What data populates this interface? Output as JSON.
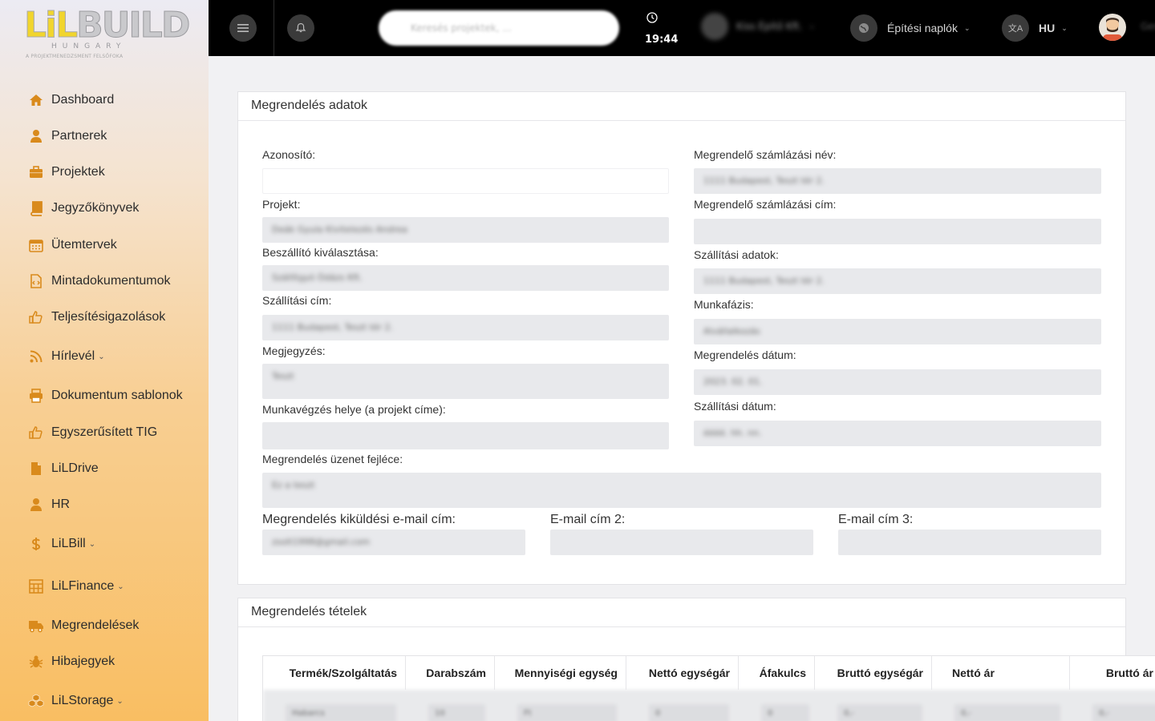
{
  "logo": {
    "li": "LiL",
    "build": "BUILD",
    "country": "HUNGARY",
    "tagline": "A PROJEKTMENEDZSMENT FELSŐFOKA"
  },
  "sidebar": {
    "items": [
      {
        "label": "Dashboard",
        "icon": "home-icon"
      },
      {
        "label": "Partnerek",
        "icon": "user-icon"
      },
      {
        "label": "Projektek",
        "icon": "briefcase-icon"
      },
      {
        "label": "Jegyzőkönyvek",
        "icon": "book-icon"
      },
      {
        "label": "Ütemtervek",
        "icon": "calendar-icon"
      },
      {
        "label": "Mintadokumentumok",
        "icon": "file-code-icon"
      },
      {
        "label": "Teljesítésigazolások",
        "icon": "thumbs-up-icon"
      },
      {
        "label": "Hírlevél",
        "icon": "rss-icon",
        "caret": "⌄"
      },
      {
        "label": "Dokumentum sablonok",
        "icon": "printer-icon"
      },
      {
        "label": "Egyszerűsített TIG",
        "icon": "thumbs-up-icon"
      },
      {
        "label": "LiLDrive",
        "icon": "file-icon"
      },
      {
        "label": "HR",
        "icon": "user-icon"
      },
      {
        "label": "LiLBill",
        "icon": "dollar-icon",
        "caret": "⌄"
      },
      {
        "label": "LiLFinance",
        "icon": "calculator-icon",
        "caret": "⌄"
      },
      {
        "label": "Megrendelések",
        "icon": "truck-icon"
      },
      {
        "label": "Hibajegyek",
        "icon": "bug-icon"
      },
      {
        "label": "LiLStorage",
        "icon": "cubes-icon",
        "caret": "⌄"
      }
    ]
  },
  "topbar": {
    "search_placeholder": "Keresés projektek, ...",
    "time": "19:44",
    "user_menu": "Kiss Építő Kft.",
    "logs_menu": "Építési naplók",
    "lang": "HU",
    "user_name": "Ger"
  },
  "order_card": {
    "title": "Megrendelés adatok",
    "left": [
      {
        "label": "Azonosító:",
        "value": ""
      },
      {
        "label": "Projekt:",
        "value": "Deák Gyula Kivitelezés Andrea"
      },
      {
        "label": "Beszállító kiválasztása:",
        "value": "Szállítgyó Ódázs Kft."
      },
      {
        "label": "Szállítási cím:",
        "value": "1111 Budapest, Teszt tér 2."
      },
      {
        "label": "Megjegyzés:",
        "value": "Teszt"
      },
      {
        "label": "Munkavégzés helye (a projekt címe):",
        "value": ""
      }
    ],
    "right": [
      {
        "label": "Megrendelő számlázási név:",
        "value": "1111 Budapest, Teszt tér 2."
      },
      {
        "label": "Megrendelő számlázási cím:",
        "value": ""
      },
      {
        "label": "Szállítási adatok:",
        "value": "1111 Budapest, Teszt tér 2."
      },
      {
        "label": "Munkafázis:",
        "value": "Alvállalkozás"
      },
      {
        "label": "Megrendelés dátum:",
        "value": "2023. 02. 01."
      },
      {
        "label": "Szállítási dátum:",
        "value": "éééé. hh. nn."
      }
    ],
    "message_header": {
      "label": "Megrendelés üzenet fejléce:",
      "value": "Ez a teszt"
    },
    "emails": [
      {
        "label": "Megrendelés kiküldési e-mail cím:",
        "value": "zsolt1998@gmail.com"
      },
      {
        "label": "E-mail cím 2:",
        "value": ""
      },
      {
        "label": "E-mail cím 3:",
        "value": ""
      }
    ]
  },
  "items_card": {
    "title": "Megrendelés tételek",
    "columns": [
      "Termék/Szolgáltatás",
      "Darabszám",
      "Mennyiségi egység",
      "Nettó egységár",
      "Áfakulcs",
      "Bruttó egységár",
      "Nettó ár",
      "Bruttó ár"
    ],
    "row": [
      "Habarcs",
      "10",
      "Ft",
      "0",
      "0",
      "0,-",
      "0,-",
      "0,-"
    ]
  }
}
